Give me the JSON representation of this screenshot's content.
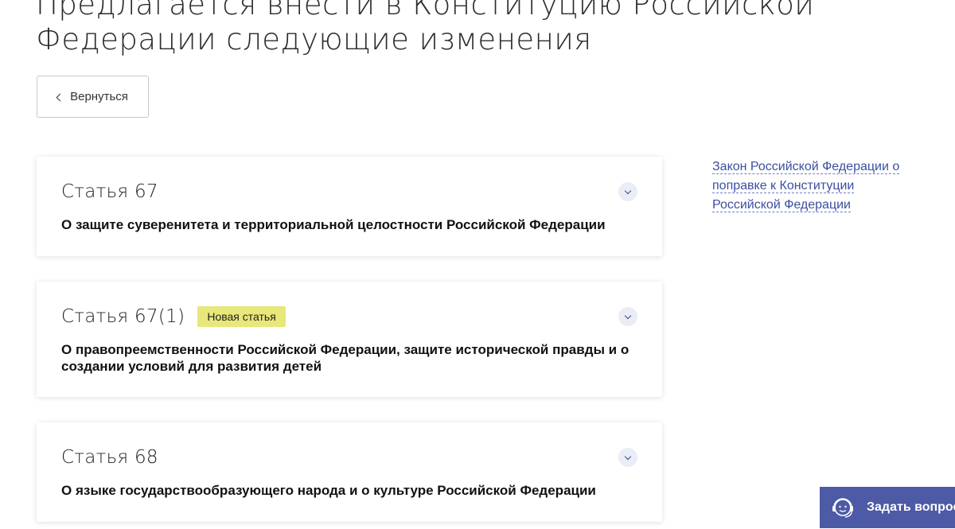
{
  "page": {
    "title": "Предлагается внести в Конституцию Российской Федерации следующие изменения"
  },
  "back_button": {
    "label": "Вернуться"
  },
  "articles": [
    {
      "number": "Статья 67",
      "badge": "",
      "subtitle": "О защите суверенитета и территориальной целостности Российской Федерации"
    },
    {
      "number": "Статья 67(1)",
      "badge": "Новая статья",
      "subtitle": "О правопреемственности Российской Федерации, защите исторической правды и о создании условий для развития детей"
    },
    {
      "number": "Статья 68",
      "badge": "",
      "subtitle": "О языке государствообразующего народа и о культуре Российской Федерации"
    }
  ],
  "sidebar": {
    "law_link": "Закон Российской Федерации о поправке к Конституции Российской Федерации"
  },
  "ask_button": {
    "label": "Задать вопрос",
    "icon": "support-agent-icon"
  },
  "colors": {
    "accent": "#4d5aa6",
    "link": "#3b4fa0",
    "badge": "#e8e77a"
  }
}
